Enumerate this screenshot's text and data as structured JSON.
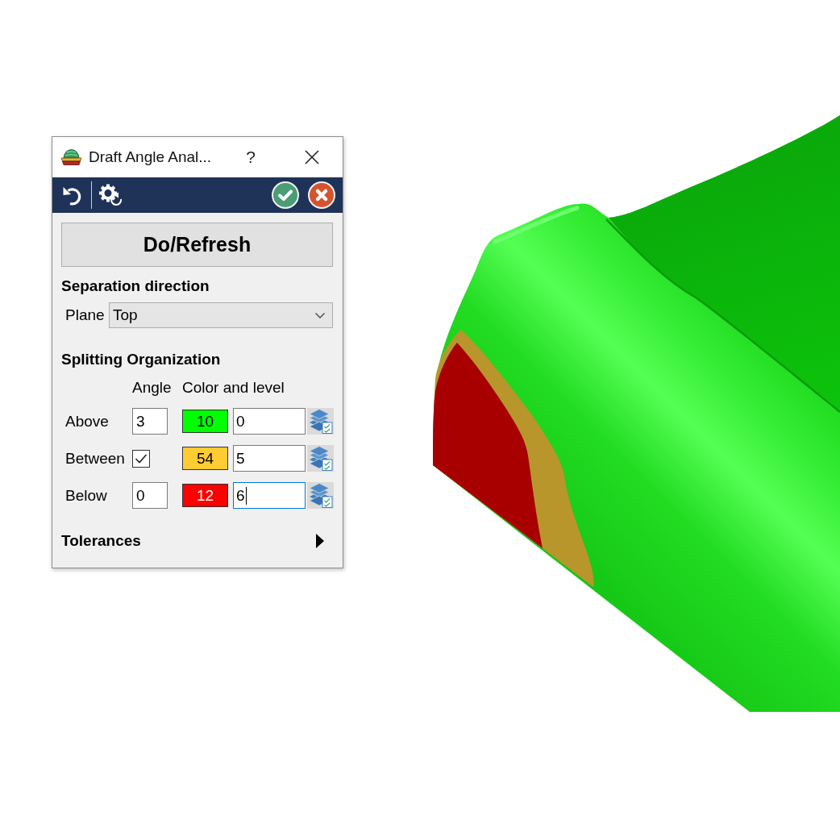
{
  "window": {
    "title": "Draft Angle Anal...",
    "help": "?"
  },
  "do_refresh": {
    "label": "Do/Refresh"
  },
  "separation": {
    "heading": "Separation direction",
    "plane_label": "Plane",
    "plane_value": "Top"
  },
  "splitting": {
    "heading": "Splitting Organization",
    "columns": [
      "Angle",
      "Color and level"
    ],
    "rows": [
      {
        "label": "Above",
        "kind": "angle",
        "angle": "3",
        "color": "#00ff00",
        "color_number": "10",
        "layer": "0",
        "focused": false
      },
      {
        "label": "Between",
        "kind": "checkbox",
        "checked": true,
        "color": "#ffcc33",
        "color_number": "54",
        "layer": "5",
        "focused": false
      },
      {
        "label": "Below",
        "kind": "angle",
        "angle": "0",
        "color": "#ff0000",
        "color_number": "12",
        "layer": "6",
        "focused": true
      }
    ]
  },
  "tolerances": {
    "heading": "Tolerances",
    "expanded": false
  }
}
